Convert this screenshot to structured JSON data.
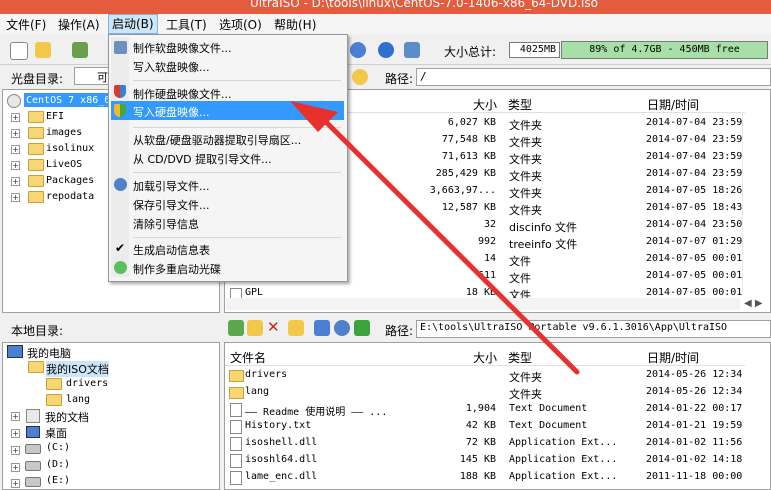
{
  "window": {
    "title": "UltraISO - D:\\tools\\linux\\CentOS-7.0-1406-x86_64-DVD.iso"
  },
  "menubar": [
    "文件(F)",
    "操作(A)",
    "启动(B)",
    "工具(T)",
    "选项(O)",
    "帮助(H)"
  ],
  "toolbar": {
    "size_label": "大小总计:",
    "size_value": "4025MB",
    "free_text": "89% of 4.7GB - 450MB free"
  },
  "iso_panel": {
    "label": "光盘目录:",
    "combo_text": "可",
    "path_label": "路径:",
    "path_value": "/"
  },
  "iso_tree": {
    "root": "CentOS 7 x86_6",
    "items": [
      "EFI",
      "images",
      "isolinux",
      "LiveOS",
      "Packages",
      "repodata"
    ]
  },
  "iso_columns": {
    "size": "大小",
    "type": "类型",
    "date": "日期/时间"
  },
  "iso_files": [
    {
      "size": "6,027 KB",
      "type": "文件夹",
      "date": "2014-07-04 23:59"
    },
    {
      "size": "77,548 KB",
      "type": "文件夹",
      "date": "2014-07-04 23:59"
    },
    {
      "size": "71,613 KB",
      "type": "文件夹",
      "date": "2014-07-04 23:59"
    },
    {
      "size": "285,429 KB",
      "type": "文件夹",
      "date": "2014-07-04 23:59"
    },
    {
      "size": "3,663,97...",
      "type": "文件夹",
      "date": "2014-07-05 18:26"
    },
    {
      "size": "12,587 KB",
      "type": "文件夹",
      "date": "2014-07-05 18:43"
    },
    {
      "size": "32",
      "type": "discinfo 文件",
      "date": "2014-07-04 23:50"
    },
    {
      "size": "992",
      "type": "treeinfo 文件",
      "date": "2014-07-07 01:29"
    },
    {
      "size": "14",
      "type": "文件",
      "date": "2014-07-05 00:01"
    },
    {
      "size": "611",
      "type": "文件",
      "date": "2014-07-05 00:01"
    },
    {
      "name": "GPL",
      "size": "18 KB",
      "type": "文件",
      "date": "2014-07-05 00:01"
    }
  ],
  "local_panel": {
    "label": "本地目录:",
    "path_label": "路径:",
    "path_value": "E:\\tools\\UltraISO Portable v9.6.1.3016\\App\\UltraISO"
  },
  "local_tree": [
    "我的电脑",
    "我的ISO文档",
    "drivers",
    "lang",
    "我的文档",
    "桌面",
    "(C:)",
    "(D:)",
    "(E:)"
  ],
  "local_columns": {
    "name": "文件名",
    "size": "大小",
    "type": "类型",
    "date": "日期/时间"
  },
  "local_files": [
    {
      "name": "drivers",
      "size": "",
      "type": "文件夹",
      "date": "2014-05-26 12:34"
    },
    {
      "name": "lang",
      "size": "",
      "type": "文件夹",
      "date": "2014-05-26 12:34"
    },
    {
      "name": "—— Readme 使用说明 —— ...",
      "size": "1,904",
      "type": "Text Document",
      "date": "2014-01-22 00:17"
    },
    {
      "name": "History.txt",
      "size": "42 KB",
      "type": "Text Document",
      "date": "2014-01-21 19:59"
    },
    {
      "name": "isoshell.dll",
      "size": "72 KB",
      "type": "Application Ext...",
      "date": "2014-01-02 11:56"
    },
    {
      "name": "isoshl64.dll",
      "size": "145 KB",
      "type": "Application Ext...",
      "date": "2014-01-02 14:18"
    },
    {
      "name": "lame_enc.dll",
      "size": "188 KB",
      "type": "Application Ext...",
      "date": "2011-11-18 00:00"
    }
  ],
  "boot_menu": {
    "items": [
      "制作软盘映像文件...",
      "写入软盘映像...",
      "制作硬盘映像文件...",
      "写入硬盘映像...",
      "从软盘/硬盘驱动器提取引导扇区...",
      "从 CD/DVD 提取引导文件...",
      "加载引导文件...",
      "保存引导文件...",
      "清除引导信息",
      "生成启动信息表",
      "制作多重启动光碟"
    ],
    "highlighted": "写入硬盘映像..."
  },
  "colors": {
    "accent": "#3399ff",
    "arrow": "#e8302c",
    "title": "#e45b3d"
  }
}
